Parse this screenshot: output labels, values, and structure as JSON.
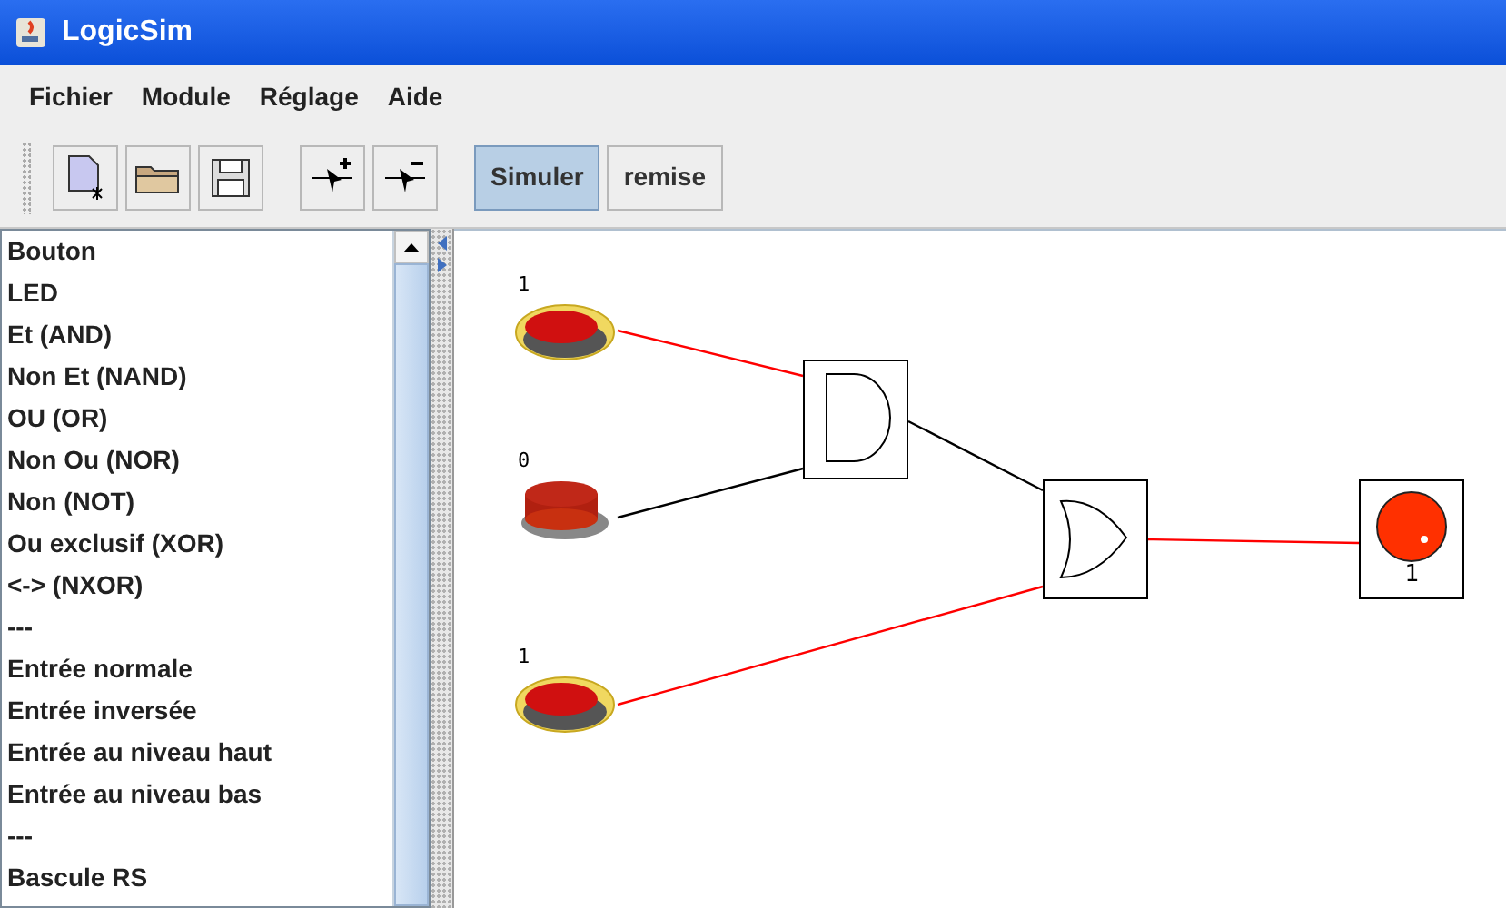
{
  "window": {
    "title": "LogicSim"
  },
  "menu": [
    "Fichier",
    "Module",
    "Réglage",
    "Aide"
  ],
  "mode_buttons": [
    {
      "label": "Simuler",
      "selected": true
    },
    {
      "label": "remise",
      "selected": false
    }
  ],
  "components": [
    "Bouton",
    "LED",
    "Et (AND)",
    "Non Et (NAND)",
    "OU (OR)",
    "Non Ou (NOR)",
    "Non (NOT)",
    "Ou exclusif (XOR)",
    "<-> (NXOR)",
    "---",
    "Entrée normale",
    "Entrée inversée",
    "Entrée au niveau haut",
    "Entrée au niveau bas",
    "---",
    "Bascule RS"
  ],
  "canvas": {
    "inputs": [
      {
        "label": "1",
        "pressed": true
      },
      {
        "label": "0",
        "pressed": false
      },
      {
        "label": "1",
        "pressed": true
      }
    ],
    "gates": [
      {
        "kind": "and"
      },
      {
        "kind": "or"
      }
    ],
    "wires": [
      {
        "active": true
      },
      {
        "active": false
      },
      {
        "active": false
      },
      {
        "active": true
      },
      {
        "active": true
      }
    ],
    "led": {
      "lit": true,
      "label": "1"
    }
  }
}
